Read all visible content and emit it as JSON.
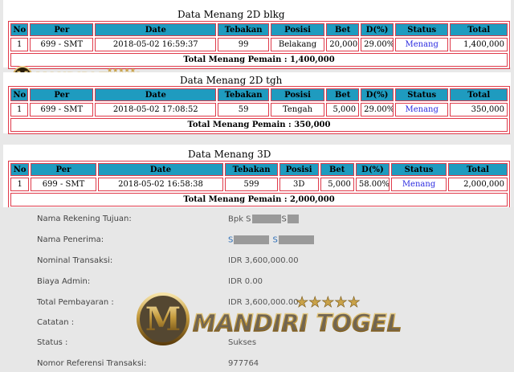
{
  "tables": [
    {
      "title": "Data  Menang 2D blkg",
      "headers": [
        "No",
        "Per",
        "Date",
        "Tebakan",
        "Posisi",
        "Bet",
        "D(%)",
        "Status",
        "Total"
      ],
      "row": [
        "1",
        "699 - SMT",
        "2018-05-02 16:59:37",
        "99",
        "Belakang",
        "20,000",
        "29.00%",
        "Menang",
        "1,400,000"
      ],
      "total_label": "Total  Menang  Pemain : 1,400,000"
    },
    {
      "title": "Data  Menang 2D tgh",
      "headers": [
        "No",
        "Per",
        "Date",
        "Tebakan",
        "Posisi",
        "Bet",
        "D(%)",
        "Status",
        "Total"
      ],
      "row": [
        "1",
        "699 - SMT",
        "2018-05-02 17:08:52",
        "59",
        "Tengah",
        "5,000",
        "29.00%",
        "Menang",
        "350,000"
      ],
      "total_label": "Total  Menang  Pemain : 350,000"
    },
    {
      "title": "Data  Menang 3D",
      "headers": [
        "No",
        "Per",
        "Date",
        "Tebakan",
        "Posisi",
        "Bet",
        "D(%)",
        "Status",
        "Total"
      ],
      "row": [
        "1",
        "699 - SMT",
        "2018-05-02 16:58:38",
        "599",
        "3D",
        "5,000",
        "58.00%",
        "Menang",
        "2,000,000"
      ],
      "total_label": "Total  Menang  Pemain : 2,000,000"
    }
  ],
  "transfer": {
    "rekening_label": "Nama Rekening Tujuan:",
    "rekening_value": "Bpk S",
    "rekening_value2": "S",
    "penerima_label": "Nama Penerima:",
    "penerima_value": "S",
    "penerima_value2": "S",
    "nominal_label": "Nominal Transaksi:",
    "nominal_value": "IDR 3,600,000.00",
    "admin_label": "Biaya Admin:",
    "admin_value": "IDR 0.00",
    "total_label": "Total Pembayaran :",
    "total_value": "IDR 3,600,000.00",
    "catatan_label": "Catatan :",
    "status_label": "Status :",
    "status_value": "Sukses",
    "ref_label": "Nomor Referensi Transaksi:",
    "ref_value": "977764"
  },
  "logo": {
    "text": "MANDIRI TOGEL",
    "letter": "M",
    "stars": "★★★★★"
  },
  "colors": {
    "header_bg": "#1f9bbf",
    "border": "#e03a4a",
    "status": "#2a2ae0",
    "gold": "#c9a24a"
  }
}
